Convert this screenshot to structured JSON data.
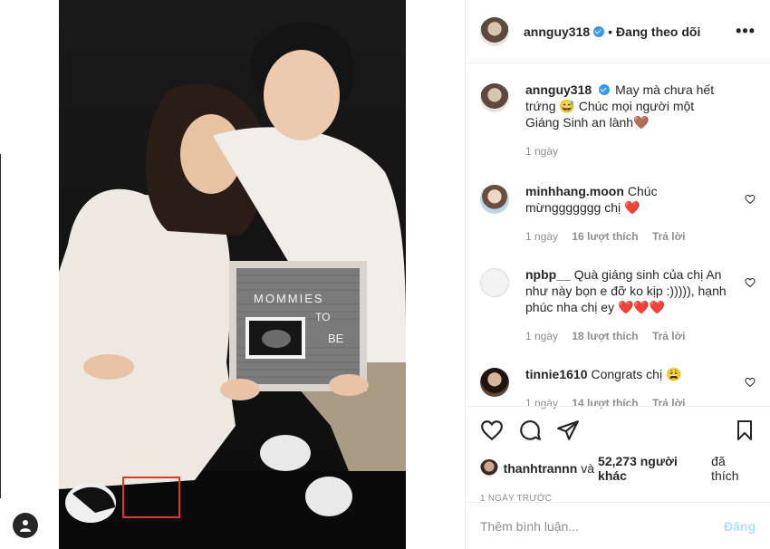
{
  "post": {
    "username": "annguy318",
    "follow_status": "Đang theo dõi",
    "separator": "•",
    "more": "•••"
  },
  "photo": {
    "board_line1": "MOMMIES",
    "board_line2": "TO",
    "board_line3": "BE"
  },
  "caption": {
    "username": "annguy318",
    "text": "May mà chưa hết trứng 😅 Chúc mọi người một Giáng Sinh an lành🤎",
    "time": "1 ngày"
  },
  "comments": [
    {
      "username": "minhhang.moon",
      "text": "Chúc mừnggggggg chị ❤️",
      "time": "1 ngày",
      "likes": "16 lượt thích",
      "reply": "Trả lời"
    },
    {
      "username": "npbp__",
      "text": "Quà giáng sinh của chị An như này bọn e đỡ ko kịp :))))), hạnh phúc nha chị ey ❤️❤️❤️",
      "time": "1 ngày",
      "likes": "18 lượt thích",
      "reply": "Trả lời"
    },
    {
      "username": "tinnie1610",
      "text": "Congrats chị 😩",
      "time": "1 ngày",
      "likes": "14 lượt thích",
      "reply": "Trả lời"
    }
  ],
  "likes": {
    "first_user": "thanhtrannn",
    "joiner": "và",
    "count_text": "52,273 người khác",
    "suffix": "đã thích"
  },
  "timestamp": "1 NGÀY TRƯỚC",
  "add_comment": {
    "placeholder": "Thêm bình luận...",
    "post_label": "Đăng"
  },
  "colors": {
    "verified": "#3897f0",
    "highlight_box": "#e0362c",
    "post_disabled": "#b2dffc",
    "meta_gray": "#8e8e8e"
  }
}
